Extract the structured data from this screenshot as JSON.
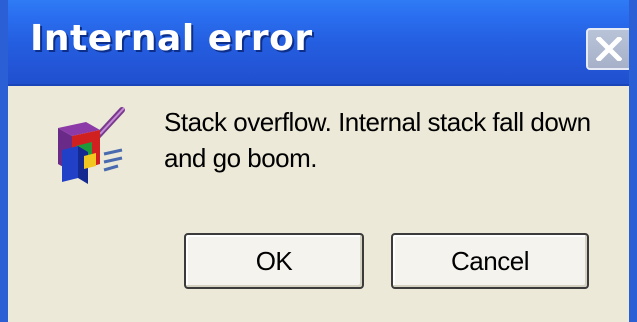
{
  "window": {
    "title": "Internal error",
    "close_icon": "close-icon",
    "colors": {
      "titlebar": "#245ee0",
      "frame": "#2a5fd6",
      "body": "#ece9d8",
      "close_button": "#a6b0c8"
    }
  },
  "dialog": {
    "icon": "installer-icon",
    "message_line1": "Stack overflow. Internal stack fall down",
    "message_line2": "and go boom."
  },
  "buttons": {
    "ok_label": "OK",
    "cancel_label": "Cancel"
  }
}
